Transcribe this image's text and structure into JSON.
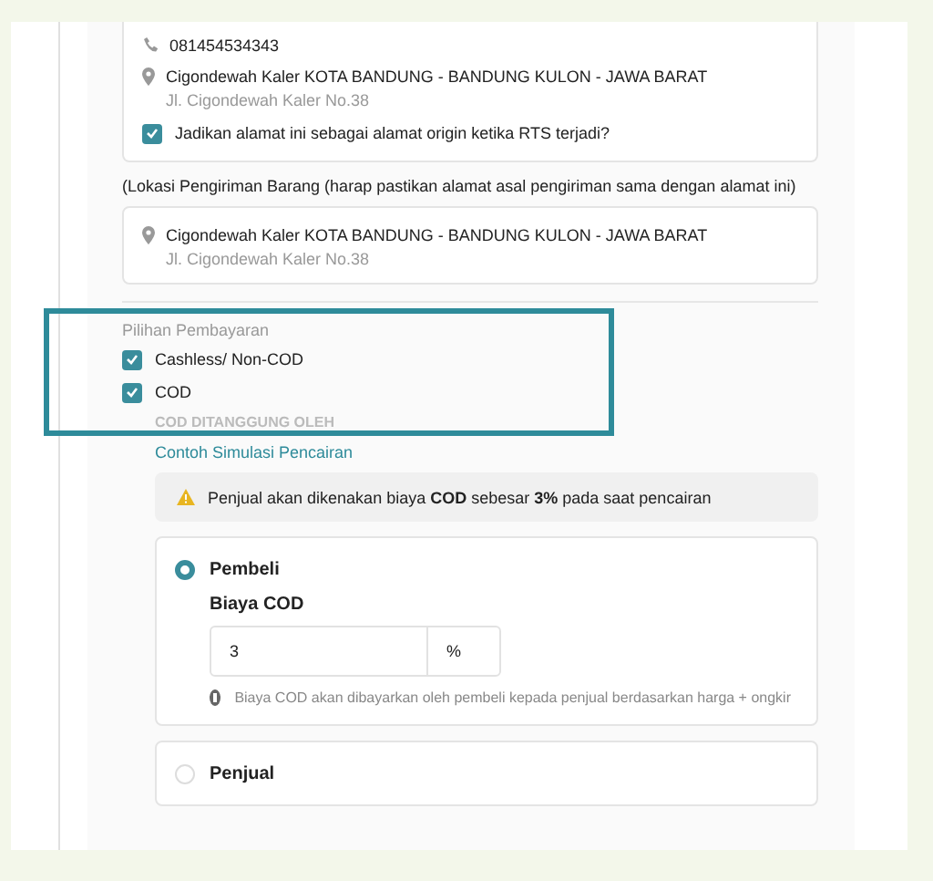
{
  "contact": {
    "phone": "081454534343",
    "address": "Cigondewah Kaler KOTA BANDUNG - BANDUNG KULON - JAWA BARAT",
    "street": "Jl. Cigondewah Kaler No.38",
    "origin_checkbox": {
      "label": "Jadikan alamat ini sebagai alamat origin ketika RTS terjadi?",
      "checked": true
    }
  },
  "shipping_location": {
    "label": "(Lokasi Pengiriman Barang (harap pastikan alamat asal pengiriman sama dengan alamat ini)",
    "address": "Cigondewah Kaler KOTA BANDUNG - BANDUNG KULON - JAWA BARAT",
    "street": "Jl. Cigondewah Kaler No.38"
  },
  "payment": {
    "title": "Pilihan Pembayaran",
    "options": [
      {
        "label": "Cashless/ Non-COD",
        "checked": true
      },
      {
        "label": "COD",
        "checked": true
      }
    ]
  },
  "cod_bearer": {
    "title": "COD DITANGGUNG OLEH",
    "simulation_link": "Contoh Simulasi Pencairan",
    "warning": "Penjual akan dikenakan biaya **COD** sebesar **3%** pada saat pencairan",
    "choices": [
      {
        "label": "Pembeli",
        "selected": true,
        "fee_label": "Biaya COD",
        "fee_value": "3",
        "fee_unit": "%",
        "note": "Biaya COD akan dibayarkan oleh pembeli kepada penjual berdasarkan harga + ongkir"
      },
      {
        "label": "Penjual",
        "selected": false
      }
    ]
  }
}
